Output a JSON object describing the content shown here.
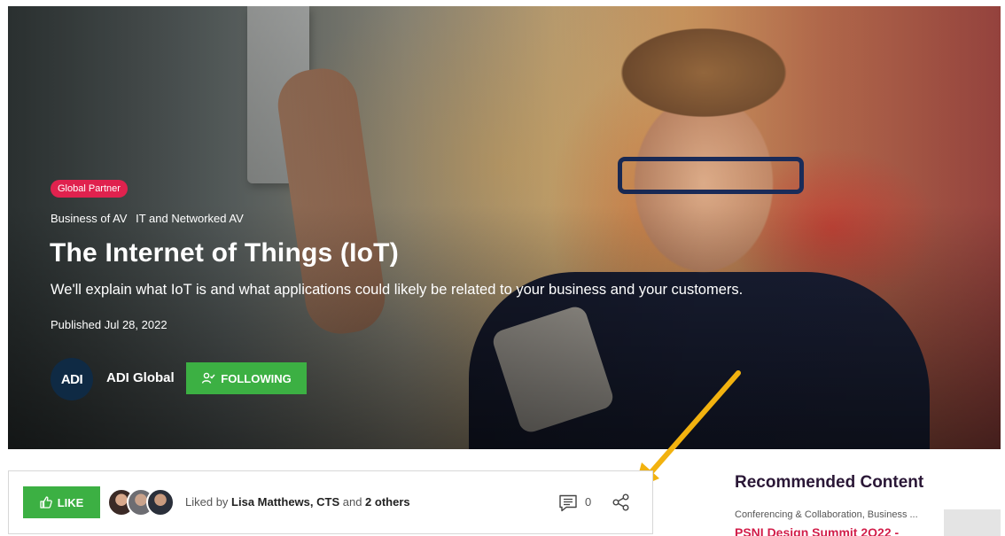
{
  "hero": {
    "badge": "Global Partner",
    "categories": [
      "Business of AV",
      "IT and Networked AV"
    ],
    "title": "The Internet of Things (IoT)",
    "subtitle": "We'll explain what IoT is and what applications could likely be related to your business and your customers.",
    "published": "Published Jul 28, 2022",
    "author": {
      "logo_text": "ADI",
      "name": "ADI Global"
    },
    "follow_label": "FOLLOWING"
  },
  "engagement": {
    "like_label": "LIKE",
    "liked_prefix": "Liked by ",
    "liked_name": "Lisa Matthews, CTS",
    "liked_middle": " and ",
    "liked_others": "2 others",
    "comment_count": "0"
  },
  "recommended": {
    "title": "Recommended Content",
    "item_meta": "Conferencing & Collaboration, Business ...",
    "item_title": "PSNI Design Summit 2O22 -"
  },
  "colors": {
    "accent_green": "#3cb043",
    "badge_pink": "#e0224e",
    "link_red": "#d21e4a",
    "arrow_yellow": "#f2b20f"
  },
  "icons": {
    "follow": "user-check-icon",
    "like": "thumbs-up-icon",
    "comment": "comment-icon",
    "share": "share-icon"
  }
}
